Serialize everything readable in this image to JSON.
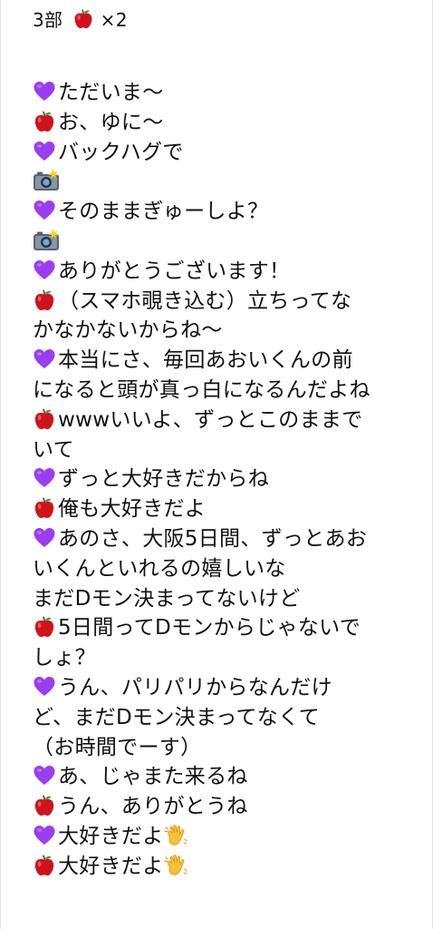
{
  "header": {
    "title": "3部",
    "count": "×2"
  },
  "lines": [
    {
      "speaker": "purple",
      "text": "ただいま～"
    },
    {
      "speaker": "apple",
      "text": "お、ゆに～"
    },
    {
      "speaker": "purple",
      "text": "バックハグで"
    },
    {
      "speaker": "camera",
      "text": ""
    },
    {
      "speaker": "purple",
      "text": "そのままぎゅーしよ？"
    },
    {
      "speaker": "camera",
      "text": ""
    },
    {
      "speaker": "purple",
      "text": "ありがとうございます！"
    },
    {
      "speaker": "apple",
      "text": "（スマホ覗き込む）立ちってな"
    },
    {
      "speaker": "none",
      "text": "かなかないからね～"
    },
    {
      "speaker": "purple",
      "text": "本当にさ、毎回あおいくんの前"
    },
    {
      "speaker": "none",
      "text": "になると頭が真っ白になるんだよね"
    },
    {
      "speaker": "apple",
      "text": "wwwいいよ、ずっとこのままで"
    },
    {
      "speaker": "none",
      "text": "いて"
    },
    {
      "speaker": "purple",
      "text": "ずっと大好きだからね"
    },
    {
      "speaker": "apple",
      "text": "俺も大好きだよ"
    },
    {
      "speaker": "purple",
      "text": "あのさ、大阪5日間、ずっとあお"
    },
    {
      "speaker": "none",
      "text": "いくんといれるの嬉しいな"
    },
    {
      "speaker": "none",
      "text": "まだDモン決まってないけど"
    },
    {
      "speaker": "apple",
      "text": "5日間ってDモンからじゃないで"
    },
    {
      "speaker": "none",
      "text": "しょ？"
    },
    {
      "speaker": "purple",
      "text": "うん、パリパリからなんだけ"
    },
    {
      "speaker": "none",
      "text": "ど、まだDモン決まってなくて"
    },
    {
      "speaker": "none",
      "text": "（お時間でーす）"
    },
    {
      "speaker": "purple",
      "text": "あ、じゃまた来るね"
    },
    {
      "speaker": "apple",
      "text": "うん、ありがとうね"
    },
    {
      "speaker": "purple",
      "text": "大好きだよ",
      "wave": true
    },
    {
      "speaker": "apple",
      "text": "大好きだよ",
      "wave": true
    }
  ],
  "icons": {
    "purple": "purple-heart-icon",
    "apple": "red-apple-icon",
    "camera": "camera-flash-icon",
    "wave": "waving-hand-icon"
  },
  "colors": {
    "purple_heart": "#9b3df0",
    "apple_red": "#d0121b",
    "text": "#111111",
    "background": "#ffffff"
  }
}
